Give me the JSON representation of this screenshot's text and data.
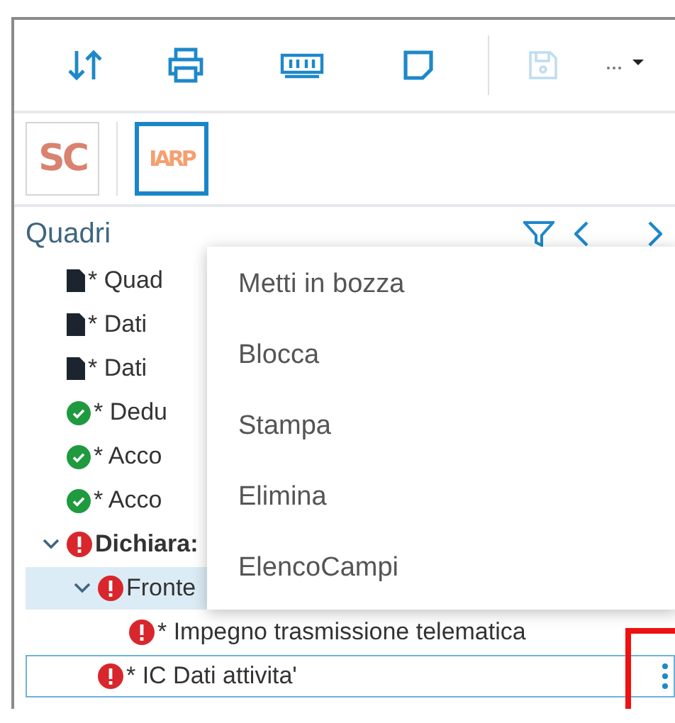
{
  "toolbar": [
    {
      "kind": "sort",
      "disabled": false
    },
    {
      "kind": "print",
      "disabled": false
    },
    {
      "kind": "memory",
      "disabled": false
    },
    {
      "kind": "note",
      "disabled": false
    },
    {
      "kind": "save",
      "disabled": true
    },
    {
      "kind": "more",
      "disabled": false
    }
  ],
  "logos": [
    {
      "text": "SC",
      "selected": false
    },
    {
      "text": "IARP",
      "selected": true
    }
  ],
  "panel": {
    "title": "Quadri"
  },
  "tree": [
    {
      "children": [
        {
          "label": "* Quad",
          "kind": "document",
          "selected": false,
          "focused": false
        },
        {
          "label": "* Dati",
          "kind": "document",
          "selected": false,
          "focused": false
        },
        {
          "label": "* Dati",
          "kind": "document",
          "selected": false,
          "focused": false
        },
        {
          "label": "* Dedu",
          "kind": "ok",
          "selected": false,
          "focused": false
        },
        {
          "label": "* Acco",
          "kind": "ok",
          "selected": false,
          "focused": false
        },
        {
          "label": "* Acco",
          "kind": "ok",
          "selected": false,
          "focused": false
        }
      ]
    },
    {
      "label": "Dichiara:",
      "kind": "error",
      "expanded": true,
      "selected": false,
      "focused": false,
      "children": [
        {
          "label": "Fronte",
          "kind": "error",
          "expanded": true,
          "selected": true,
          "focused": false,
          "children": [
            {
              "label": "* Impegno trasmissione telematica",
              "kind": "error",
              "selected": false,
              "focused": false
            }
          ]
        },
        {
          "label": "* IC Dati attivita'",
          "kind": "error",
          "selected": false,
          "focused": true,
          "options": true
        }
      ]
    }
  ],
  "context_menu": [
    "Metti in bozza",
    "Blocca",
    "Stampa",
    "Elimina",
    "ElencoCampi"
  ]
}
